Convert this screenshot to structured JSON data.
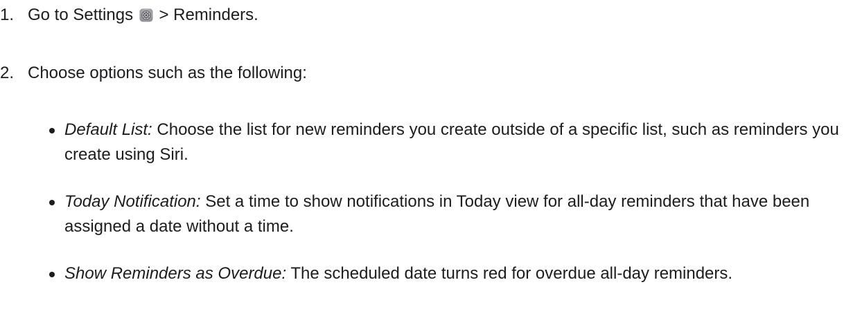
{
  "steps": [
    {
      "number": "1.",
      "text_before_icon": "Go to Settings",
      "icon": "settings-gear-icon",
      "text_after_icon": "> Reminders."
    },
    {
      "number": "2.",
      "text": "Choose options such as the following:"
    }
  ],
  "options": [
    {
      "term": "Default List:",
      "description": "Choose the list for new reminders you create outside of a specific list, such as reminders you create using Siri."
    },
    {
      "term": "Today Notification:",
      "description": "Set a time to show notifications in Today view for all-day reminders that have been assigned a date without a time."
    },
    {
      "term": "Show Reminders as Overdue:",
      "description": "The scheduled date turns red for overdue all-day reminders."
    }
  ],
  "colors": {
    "text": "#1d1d1f",
    "icon_gray": "#8e8e93"
  }
}
